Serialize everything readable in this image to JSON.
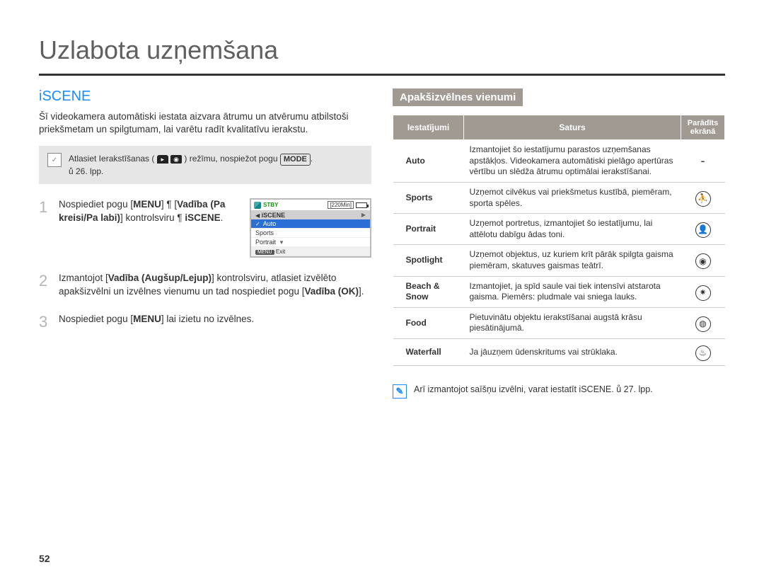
{
  "title": "Uzlabota uzņemšana",
  "section": "iSCENE",
  "intro": "Šī videokamera automātiski iestata aizvara ātrumu un atvērumu atbilstoši priekšmetam un spilgtumam, lai varētu radīt kvalitatīvu ierakstu.",
  "notice": {
    "pre": "Atlasiet Ierakstīšanas (",
    "post": ") režīmu, nospiežot pogu",
    "mode_btn": "MODE",
    "period": ".",
    "ref": "ů 26. lpp."
  },
  "steps": [
    {
      "n": "1",
      "text_parts": [
        "Nospiediet pogu [",
        "MENU",
        "] ¶ [",
        "Vadība (Pa kreisi/Pa labi)",
        "] kontrolsviru ¶ ",
        "iSCENE",
        "."
      ]
    },
    {
      "n": "2",
      "text_parts": [
        "Izmantojot [",
        "Vadība (Augšup/Lejup)",
        "] kontrolsviru, atlasiet izvēlēto apakšizvēlni un izvēlnes vienumu un tad nospiediet pogu [",
        "Vadība (OK)",
        "]."
      ]
    },
    {
      "n": "3",
      "text_parts": [
        "Nospiediet pogu [",
        "MENU",
        "] lai izietu no izvēlnes."
      ]
    }
  ],
  "lcd": {
    "stby": "STBY",
    "time": "[220Min]",
    "title": "iSCENE",
    "items": [
      "Auto",
      "Sports",
      "Portrait"
    ],
    "exit_label": "Exit",
    "menu_label": "MENU"
  },
  "submenu_header": "Apakšizvēlnes vienumi",
  "table": {
    "headers": [
      "Iestatījumi",
      "Saturs",
      "Parādīts ekrānā"
    ],
    "rows": [
      {
        "name": "Auto",
        "desc": "Izmantojiet šo iestatījumu parastos uzņemšanas apstākļos. Videokamera automātiski pielāgo apertūras vērtību un slēdža ātrumu optimālai ierakstīšanai.",
        "icon": "-"
      },
      {
        "name": "Sports",
        "desc": "Uzņemot cilvēkus vai priekšmetus kustībā, piemēram, sporta spēles.",
        "icon": "⛹"
      },
      {
        "name": "Portrait",
        "desc": "Uzņemot portretus, izmantojiet šo iestatījumu, lai attēlotu dabīgu ādas toni.",
        "icon": "👤"
      },
      {
        "name": "Spotlight",
        "desc": "Uzņemot objektus, uz kuriem krīt pārāk spilgta gaisma piemēram, skatuves gaismas teātrī.",
        "icon": "◉"
      },
      {
        "name": "Beach & Snow",
        "desc": "Izmantojiet, ja spīd saule vai tiek intensīvi atstarota gaisma. Piemērs: pludmale vai sniega lauks.",
        "icon": "✷"
      },
      {
        "name": "Food",
        "desc": "Pietuvinātu objektu ierakstīšanai augstā krāsu piesātinājumā.",
        "icon": "◍"
      },
      {
        "name": "Waterfall",
        "desc": "Ja jāuzņem ūdenskritums vai strūklaka.",
        "icon": "♨"
      }
    ]
  },
  "tip": "Arī izmantojot saīšņu izvēlni, varat iestatīt iSCENE. ů 27. lpp.",
  "page_number": "52"
}
